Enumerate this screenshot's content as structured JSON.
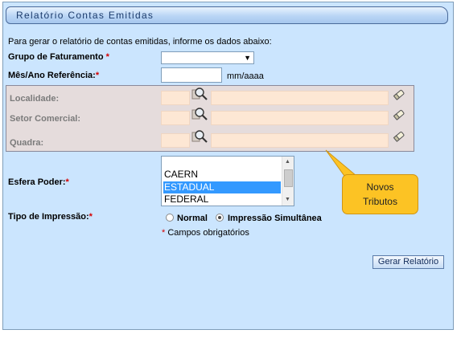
{
  "title": "Relatório Contas Emitidas",
  "intro": "Para gerar o relatório de contas emitidas, informe os dados abaixo:",
  "asterisk": "*",
  "grupo": {
    "label": "Grupo de Faturamento",
    "value": ""
  },
  "mes": {
    "label": "Mês/Ano Referência:",
    "value": "",
    "hint": "mm/aaaa"
  },
  "localidade": {
    "label": "Localidade:"
  },
  "setor": {
    "label": "Setor Comercial:"
  },
  "quadra": {
    "label": "Quadra:"
  },
  "esfera": {
    "label": "Esfera Poder:",
    "options": [
      "CAERN",
      "ESTADUAL",
      "FEDERAL"
    ],
    "selected": "ESTADUAL"
  },
  "impressao": {
    "label": "Tipo de Impressão:",
    "opt_normal": "Normal",
    "opt_simultanea": "Impressão Simultânea",
    "selected": "Impressão Simultânea"
  },
  "required_note": "Campos obrigatórios",
  "submit_label": "Gerar Relatório",
  "callout": {
    "line1": "Novos",
    "line2": "Tributos"
  },
  "colors": {
    "panel": "#cbe5fe",
    "callout": "#fcc324",
    "required": "#d40000",
    "selection": "#3399ff"
  }
}
